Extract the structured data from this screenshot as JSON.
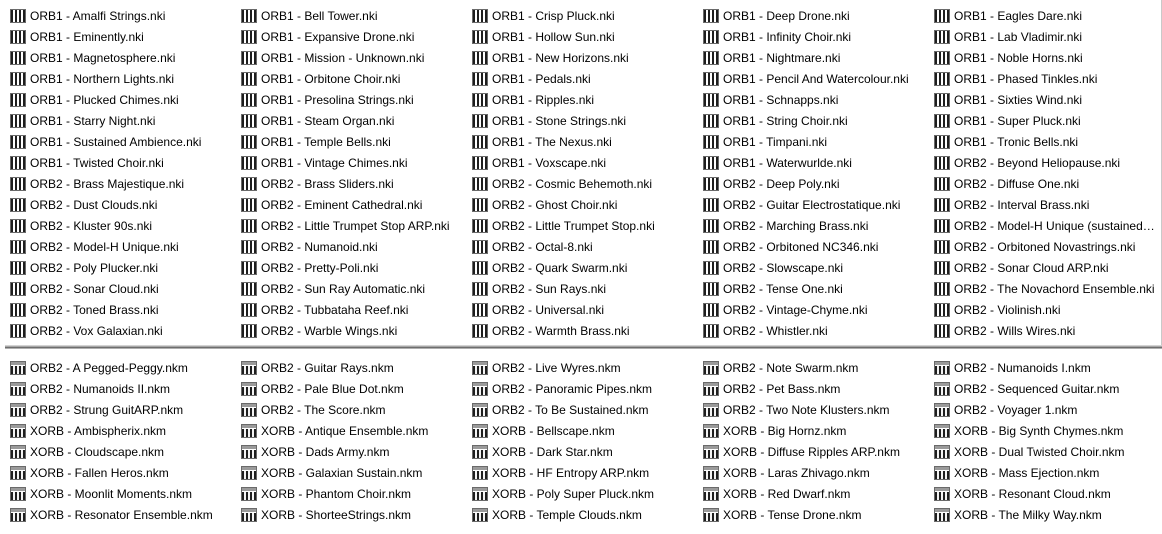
{
  "nki_panel": {
    "icon": "kontakt-instrument-icon",
    "items": [
      "ORB1 - Amalfi Strings.nki",
      "ORB1 - Bell Tower.nki",
      "ORB1 - Crisp Pluck.nki",
      "ORB1 - Deep Drone.nki",
      "ORB1 - Eagles Dare.nki",
      "ORB1 - Eminently.nki",
      "ORB1 - Expansive Drone.nki",
      "ORB1 - Hollow Sun.nki",
      "ORB1 - Infinity Choir.nki",
      "ORB1 - Lab Vladimir.nki",
      "ORB1 - Magnetosphere.nki",
      "ORB1 - Mission - Unknown.nki",
      "ORB1 - New Horizons.nki",
      "ORB1 - Nightmare.nki",
      "ORB1 - Noble Horns.nki",
      "ORB1 - Northern Lights.nki",
      "ORB1 - Orbitone Choir.nki",
      "ORB1 - Pedals.nki",
      "ORB1 - Pencil And Watercolour.nki",
      "ORB1 - Phased Tinkles.nki",
      "ORB1 - Plucked Chimes.nki",
      "ORB1 - Presolina Strings.nki",
      "ORB1 - Ripples.nki",
      "ORB1 - Schnapps.nki",
      "ORB1 - Sixties Wind.nki",
      "ORB1 - Starry Night.nki",
      "ORB1 - Steam Organ.nki",
      "ORB1 - Stone Strings.nki",
      "ORB1 - String Choir.nki",
      "ORB1 - Super Pluck.nki",
      "ORB1 - Sustained Ambience.nki",
      "ORB1 - Temple Bells.nki",
      "ORB1 - The Nexus.nki",
      "ORB1 - Timpani.nki",
      "ORB1 - Tronic Bells.nki",
      "ORB1 - Twisted Choir.nki",
      "ORB1 - Vintage Chimes.nki",
      "ORB1 - Voxscape.nki",
      "ORB1 - Waterwurlde.nki",
      "ORB2 - Beyond Heliopause.nki",
      "ORB2 - Brass Majestique.nki",
      "ORB2 - Brass Sliders.nki",
      "ORB2 - Cosmic Behemoth.nki",
      "ORB2 - Deep Poly.nki",
      "ORB2 - Diffuse One.nki",
      "ORB2 - Dust Clouds.nki",
      "ORB2 - Eminent Cathedral.nki",
      "ORB2 - Ghost Choir.nki",
      "ORB2 - Guitar Electrostatique.nki",
      "ORB2 - Interval Brass.nki",
      "ORB2 - Kluster 90s.nki",
      "ORB2 - Little Trumpet Stop ARP.nki",
      "ORB2 - Little Trumpet Stop.nki",
      "ORB2 - Marching Brass.nki",
      "ORB2 - Model-H Unique (sustained)....",
      "ORB2 - Model-H Unique.nki",
      "ORB2 - Numanoid.nki",
      "ORB2 - Octal-8.nki",
      "ORB2 - Orbitoned NC346.nki",
      "ORB2 - Orbitoned Novastrings.nki",
      "ORB2 - Poly Plucker.nki",
      "ORB2 - Pretty-Poli.nki",
      "ORB2 - Quark Swarm.nki",
      "ORB2 - Slowscape.nki",
      "ORB2 - Sonar Cloud ARP.nki",
      "ORB2 - Sonar Cloud.nki",
      "ORB2 - Sun Ray Automatic.nki",
      "ORB2 - Sun Rays.nki",
      "ORB2 - Tense One.nki",
      "ORB2 - The Novachord Ensemble.nki",
      "ORB2 - Toned Brass.nki",
      "ORB2 - Tubbataha Reef.nki",
      "ORB2 - Universal.nki",
      "ORB2 - Vintage-Chyme.nki",
      "ORB2 - Violinish.nki",
      "ORB2 - Vox Galaxian.nki",
      "ORB2 - Warble Wings.nki",
      "ORB2 - Warmth Brass.nki",
      "ORB2 - Whistler.nki",
      "ORB2 - Wills Wires.nki"
    ]
  },
  "nkm_panel": {
    "icon": "kontakt-multi-icon",
    "items": [
      "ORB2 - A Pegged-Peggy.nkm",
      "ORB2 - Guitar Rays.nkm",
      "ORB2 - Live Wyres.nkm",
      "ORB2 - Note Swarm.nkm",
      "ORB2 - Numanoids I.nkm",
      "ORB2 - Numanoids II.nkm",
      "ORB2 - Pale Blue Dot.nkm",
      "ORB2 - Panoramic Pipes.nkm",
      "ORB2 - Pet Bass.nkm",
      "ORB2 - Sequenced Guitar.nkm",
      "ORB2 - Strung GuitARP.nkm",
      "ORB2 - The Score.nkm",
      "ORB2 - To Be Sustained.nkm",
      "ORB2 - Two Note Klusters.nkm",
      "ORB2 - Voyager 1.nkm",
      "XORB - Ambispherix.nkm",
      "XORB - Antique Ensemble.nkm",
      "XORB - Bellscape.nkm",
      "XORB - Big Hornz.nkm",
      "XORB - Big Synth Chymes.nkm",
      "XORB - Cloudscape.nkm",
      "XORB - Dads Army.nkm",
      "XORB - Dark Star.nkm",
      "XORB - Diffuse Ripples ARP.nkm",
      "XORB - Dual Twisted Choir.nkm",
      "XORB - Fallen Heros.nkm",
      "XORB - Galaxian Sustain.nkm",
      "XORB - HF Entropy ARP.nkm",
      "XORB - Laras Zhivago.nkm",
      "XORB - Mass Ejection.nkm",
      "XORB - Moonlit Moments.nkm",
      "XORB - Phantom Choir.nkm",
      "XORB - Poly Super Pluck.nkm",
      "XORB - Red Dwarf.nkm",
      "XORB - Resonant Cloud.nkm",
      "XORB - Resonator Ensemble.nkm",
      "XORB - ShorteeStrings.nkm",
      "XORB - Temple Clouds.nkm",
      "XORB - Tense Drone.nkm",
      "XORB - The Milky Way.nkm"
    ]
  }
}
